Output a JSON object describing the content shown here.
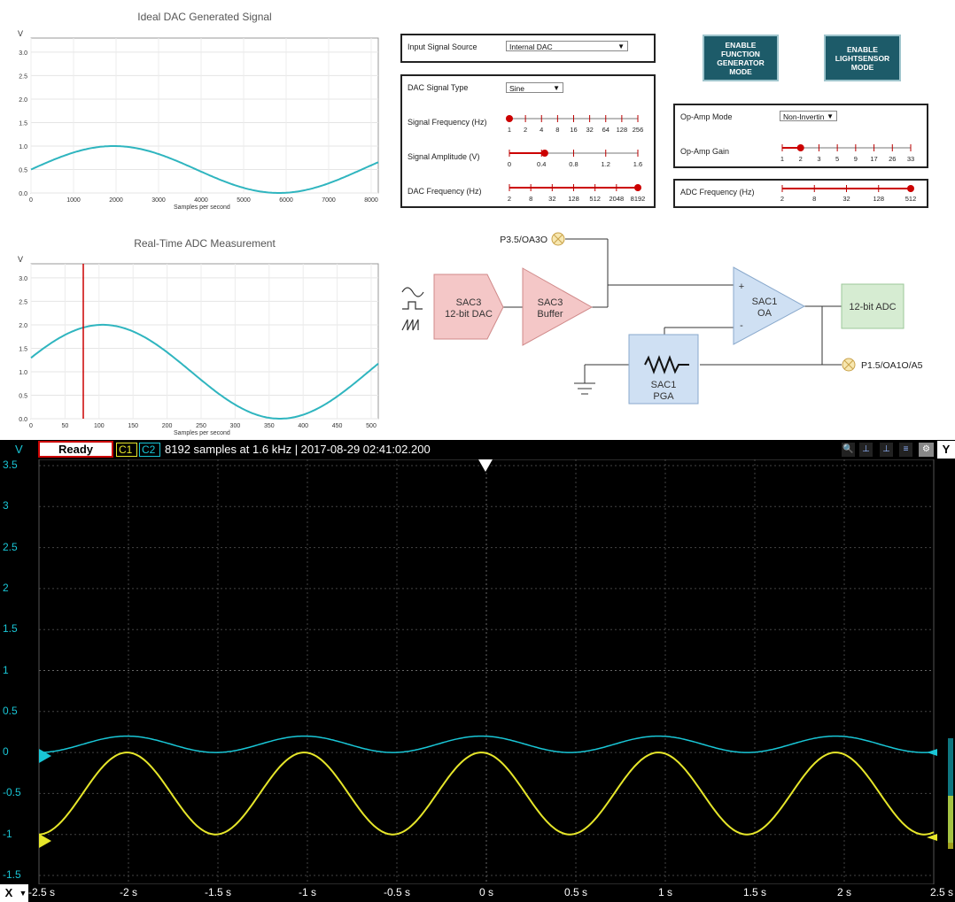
{
  "dac_chart": {
    "title": "Ideal DAC Generated Signal",
    "ylabel": "V",
    "xlabel": "Samples per second",
    "yticks": [
      "0.0",
      "0.5",
      "1.0",
      "1.5",
      "2.0",
      "2.5",
      "3.0"
    ],
    "xticks": [
      "0",
      "1000",
      "2000",
      "3000",
      "4000",
      "5000",
      "6000",
      "7000",
      "8000"
    ]
  },
  "adc_chart": {
    "title": "Real-Time ADC Measurement",
    "ylabel": "V",
    "xlabel": "Samples per second",
    "yticks": [
      "0.0",
      "0.5",
      "1.0",
      "1.5",
      "2.0",
      "2.5",
      "3.0"
    ],
    "xticks": [
      "0",
      "50",
      "100",
      "150",
      "200",
      "250",
      "300",
      "350",
      "400",
      "450",
      "500"
    ]
  },
  "controls": {
    "input_source_label": "Input Signal Source",
    "input_source_value": "Internal DAC",
    "dac_type_label": "DAC Signal Type",
    "dac_type_value": "Sine",
    "signal_freq_label": "Signal Frequency (Hz)",
    "signal_freq_ticks": [
      "1",
      "2",
      "4",
      "8",
      "16",
      "32",
      "64",
      "128",
      "256"
    ],
    "signal_amp_label": "Signal Amplitude (V)",
    "signal_amp_ticks": [
      "0",
      "0.4",
      "0.8",
      "1.2",
      "1.6"
    ],
    "dac_freq_label": "DAC Frequency (Hz)",
    "dac_freq_ticks": [
      "2",
      "8",
      "32",
      "128",
      "512",
      "2048",
      "8192"
    ],
    "opamp_mode_label": "Op-Amp Mode",
    "opamp_mode_value": "Non-Invertin",
    "opamp_gain_label": "Op-Amp Gain",
    "opamp_gain_ticks": [
      "1",
      "2",
      "3",
      "5",
      "9",
      "17",
      "26",
      "33"
    ],
    "adc_freq_label": "ADC Frequency (Hz)",
    "adc_freq_ticks": [
      "2",
      "8",
      "32",
      "128",
      "512"
    ],
    "btn_function_gen": "ENABLE FUNCTION GENERATOR MODE",
    "btn_lightsensor": "ENABLE LIGHTSENSOR MODE"
  },
  "diagram": {
    "p35": "P3.5/OA3O",
    "dac_l1": "SAC3",
    "dac_l2": "12-bit DAC",
    "buf_l1": "SAC3",
    "buf_l2": "Buffer",
    "oa_l1": "SAC1",
    "oa_l2": "OA",
    "plus": "+",
    "minus": "-",
    "adc": "12-bit ADC",
    "pga_l1": "SAC1",
    "pga_l2": "PGA",
    "p15": "P1.5/OA1O/A5"
  },
  "scope": {
    "status": "Ready",
    "ch1": "C1",
    "ch2": "C2",
    "info": "8192 samples at 1.6 kHz | 2017-08-29 02:41:02.200",
    "y_unit": "V",
    "y_axis_btn": "Y",
    "x_axis_btn": "X",
    "y_ticks": [
      "3.5",
      "3",
      "2.5",
      "2",
      "1.5",
      "1",
      "0.5",
      "0",
      "-0.5",
      "-1",
      "-1.5"
    ],
    "x_ticks": [
      "-2.5 s",
      "-2 s",
      "-1.5 s",
      "-1 s",
      "-0.5 s",
      "0 s",
      "0.5 s",
      "1 s",
      "1.5 s",
      "2 s",
      "2.5 s"
    ],
    "colors": {
      "c1": "#e6e62a",
      "c2": "#19c6d6"
    }
  }
}
